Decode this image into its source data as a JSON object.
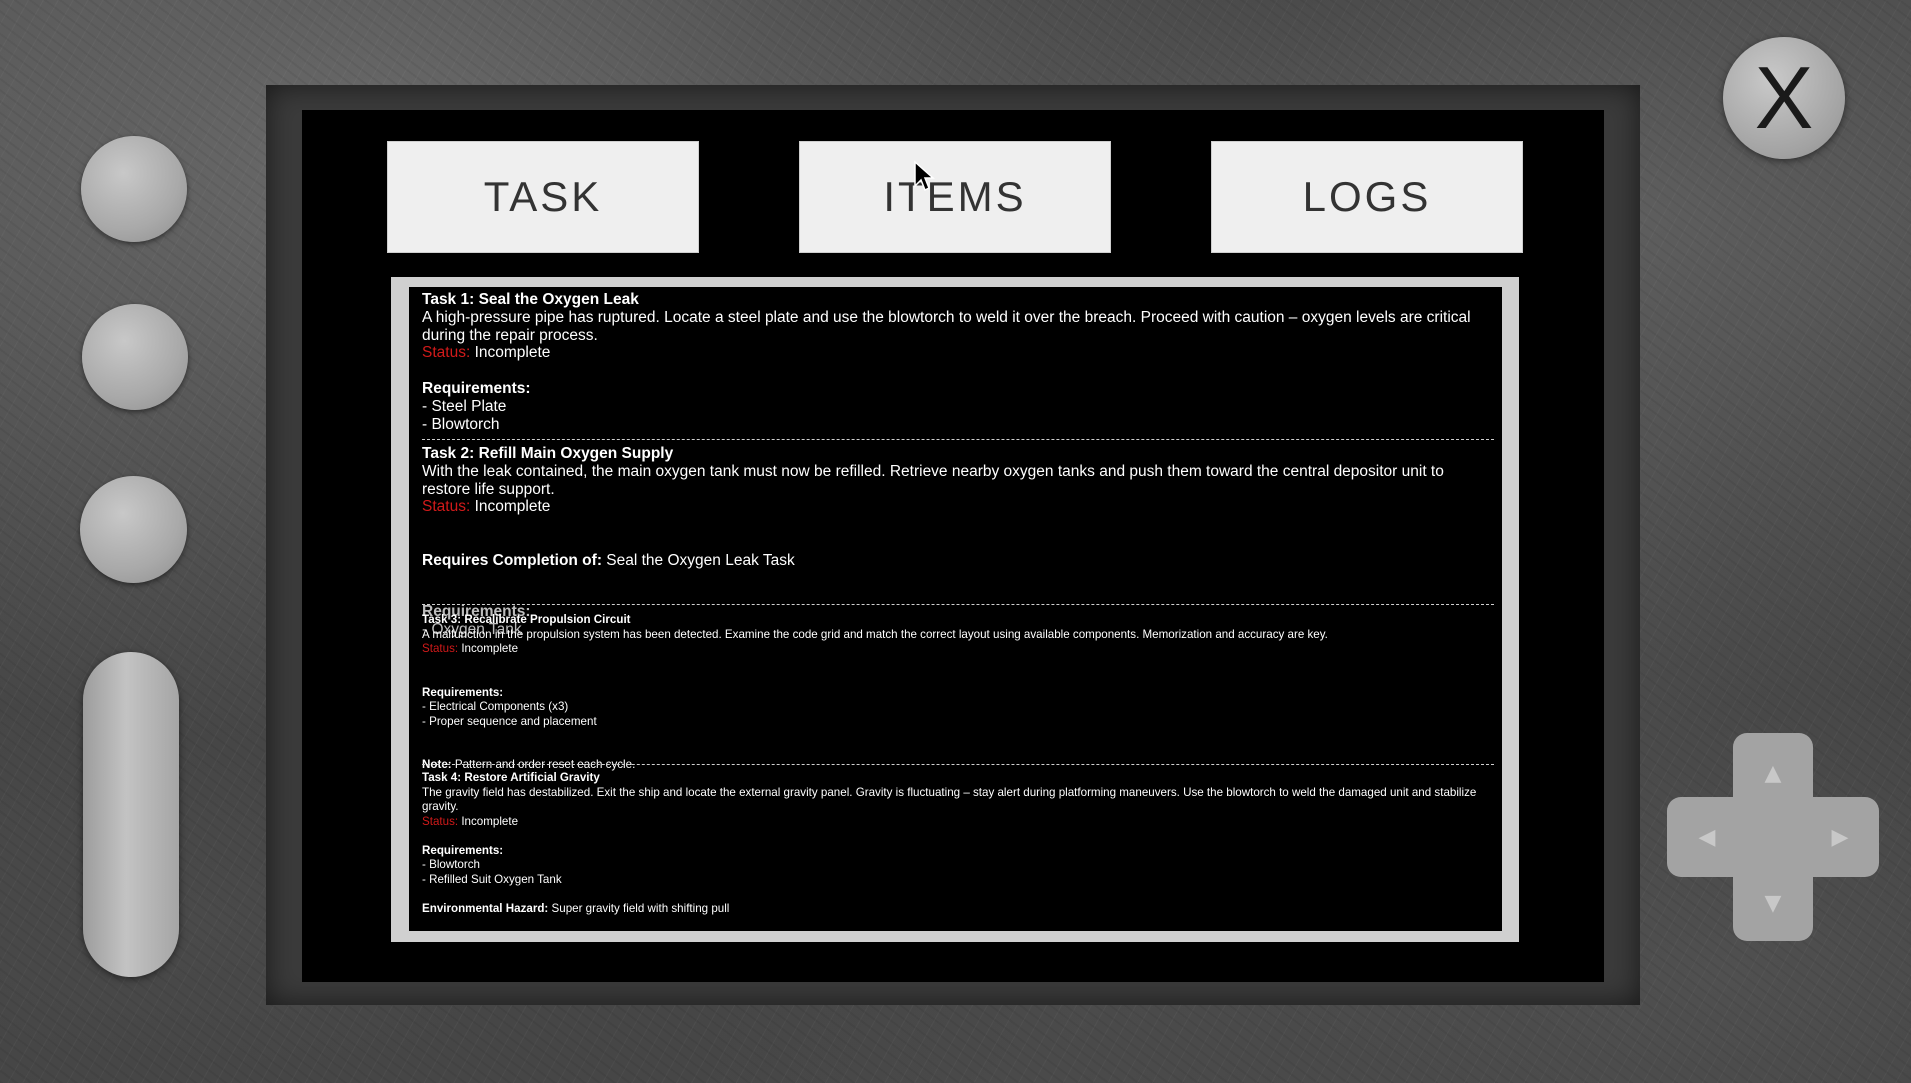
{
  "tabs": {
    "task": "TASK",
    "items": "ITEMS",
    "logs": "LOGS"
  },
  "close_label": "X",
  "status_label": "Status:",
  "tasks": [
    {
      "title": "Task 1: Seal the Oxygen Leak",
      "description": "A high-pressure pipe has ruptured. Locate a steel plate and use the blowtorch to weld it over the breach. Proceed with caution – oxygen levels are critical during the repair process.",
      "status": "Incomplete",
      "requirements_heading": "Requirements:",
      "requirements": [
        "- Steel Plate",
        "- Blowtorch"
      ]
    },
    {
      "title": "Task 2: Refill Main Oxygen Supply",
      "description": "With the leak contained, the main oxygen tank must now be refilled. Retrieve nearby oxygen tanks and push them toward the central depositor unit to restore life support.",
      "status": "Incomplete",
      "requires_completion_label": "Requires Completion of:",
      "requires_completion_value": "Seal the Oxygen Leak Task",
      "requirements_heading": "Requirements:",
      "requirements": [
        "- Oxygen Tank"
      ]
    },
    {
      "title": "Task 3: Recalibrate Propulsion Circuit",
      "description": "A malfunction in the propulsion system has been detected. Examine the code grid and match the correct layout using available components. Memorization and accuracy are key.",
      "status": "Incomplete",
      "requirements_heading": "Requirements:",
      "requirements": [
        "- Electrical Components (x3)",
        "- Proper sequence and placement"
      ],
      "note_label": "Note:",
      "note_value": "Pattern and order reset each cycle."
    },
    {
      "title": "Task 4: Restore Artificial Gravity",
      "description": "The gravity field has destabilized. Exit the ship and locate the external gravity panel. Gravity is fluctuating – stay alert during platforming maneuvers. Use the blowtorch to weld the damaged unit and stabilize gravity.",
      "status": "Incomplete",
      "requirements_heading": "Requirements:",
      "requirements": [
        "- Blowtorch",
        "- Refilled Suit Oxygen Tank"
      ],
      "hazard_label": "Environmental Hazard:",
      "hazard_value": "Super gravity field with shifting pull"
    }
  ],
  "dpad": {
    "up_icon": "arrow-up-icon",
    "down_icon": "arrow-down-icon",
    "left_icon": "arrow-left-icon",
    "right_icon": "arrow-right-icon"
  },
  "colors": {
    "status_red": "#d11a1a",
    "tab_bg": "#efefef",
    "panel_bg": "#000000"
  }
}
